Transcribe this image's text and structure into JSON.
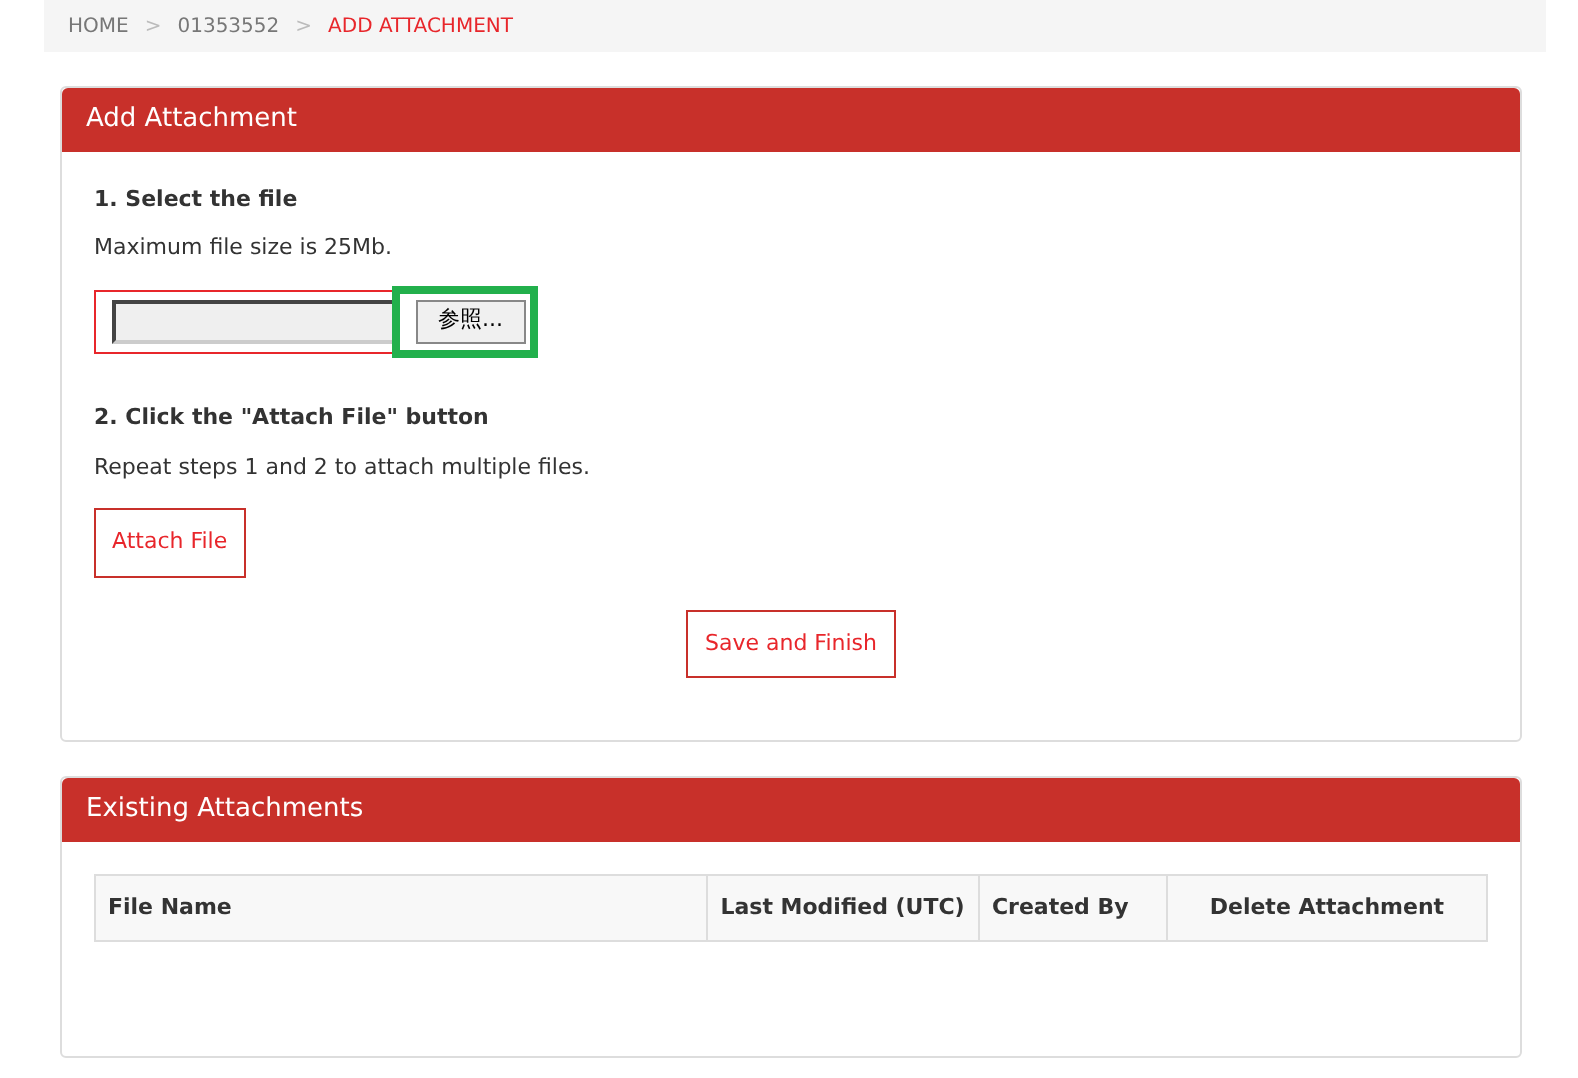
{
  "breadcrumb": [
    {
      "label": "HOME",
      "selected": false
    },
    {
      "label": "01353552",
      "selected": false
    },
    {
      "label": "ADD ATTACHMENT",
      "selected": true
    }
  ],
  "breadcrumb_separator": ">",
  "add_panel": {
    "title": "Add Attachment",
    "step1": {
      "heading": "1. Select the file",
      "note": "Maximum file size is 25Mb.",
      "browse_button": "参照...",
      "highlighted": true
    },
    "step2": {
      "heading": "2. Click the \"Attach File\" button",
      "note": "Repeat steps 1 and 2 to attach multiple files.",
      "button": "Attach File"
    },
    "finish_button": "Save and Finish"
  },
  "existing_panel": {
    "title": "Existing Attachments",
    "table": {
      "columns": [
        "File Name",
        "Last Modified (UTC)",
        "Created By",
        "Delete Attachment"
      ]
    }
  }
}
